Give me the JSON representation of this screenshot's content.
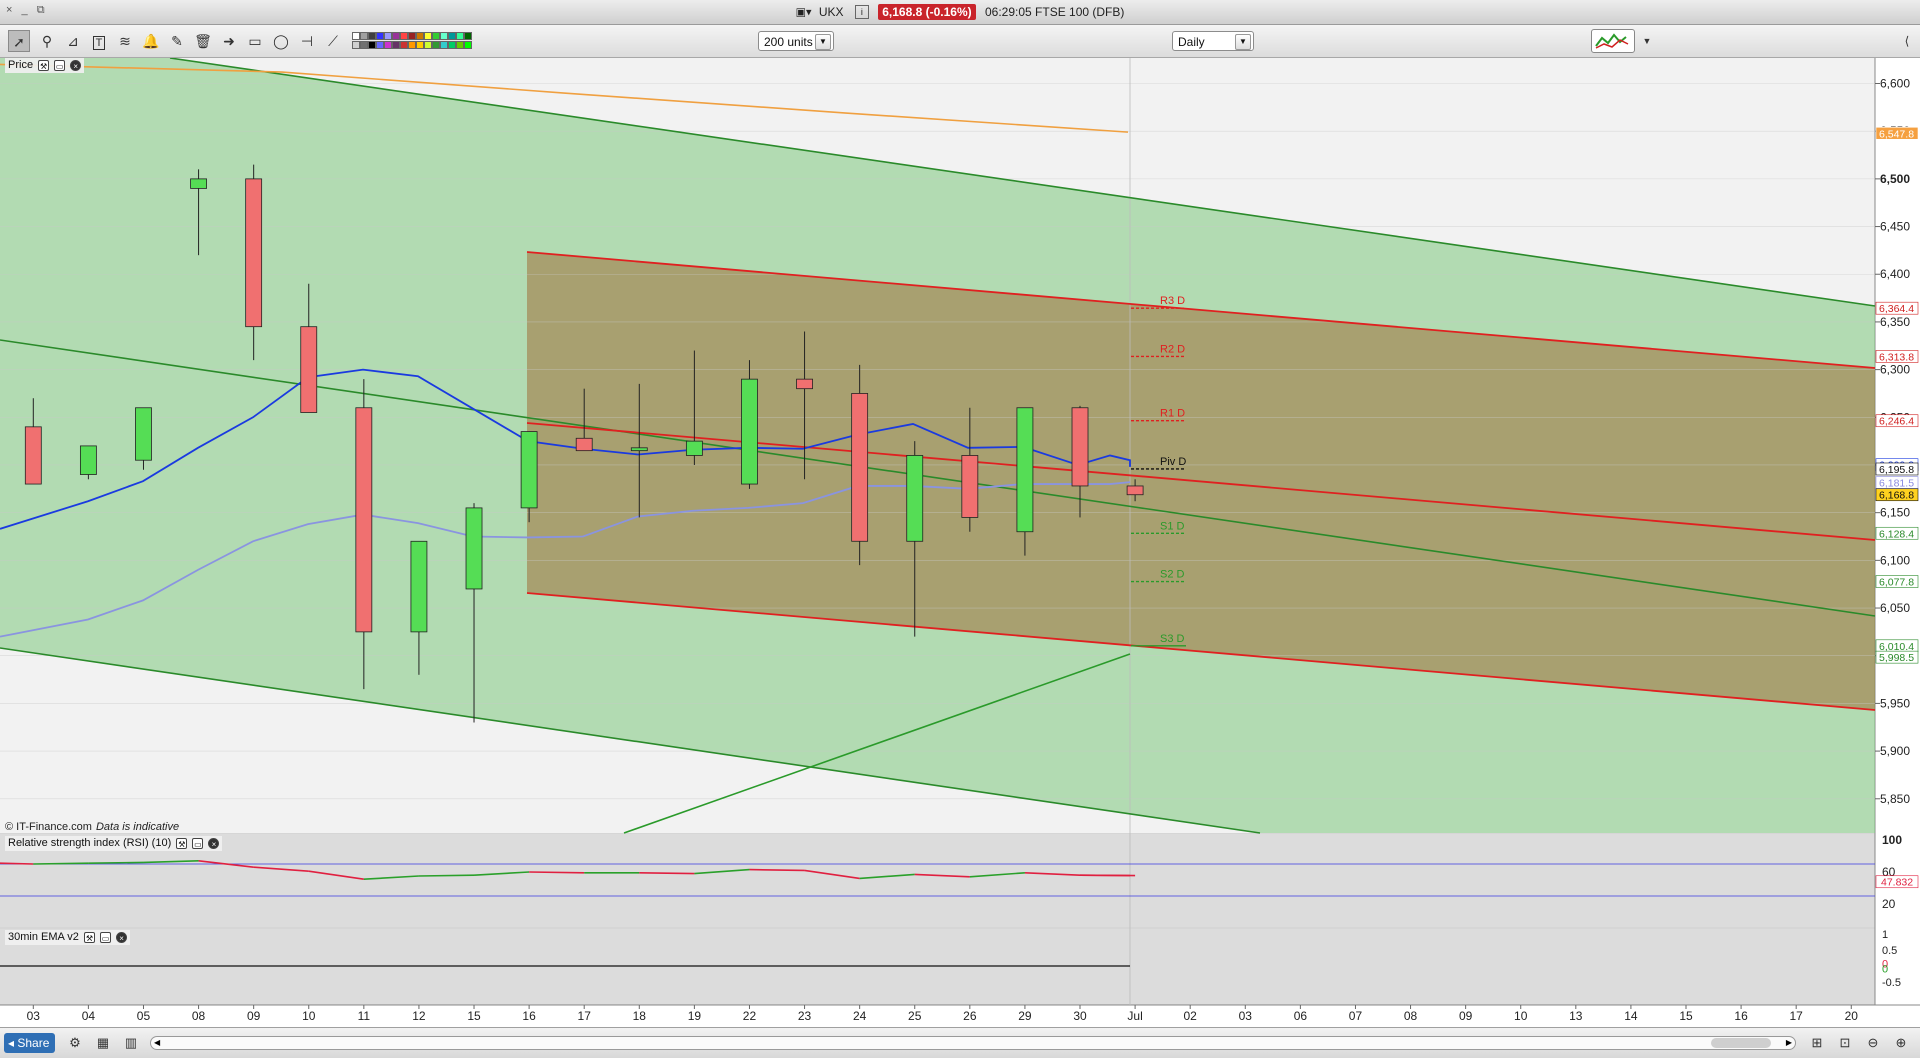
{
  "window": {
    "controls": [
      "×",
      "_",
      "⧉"
    ],
    "ticker": "UKX",
    "price_badge": "6,168.8 (-0.16%)",
    "time_title": "06:29:05 FTSE 100 (DFB)"
  },
  "toolbar": {
    "units_select": "200 units",
    "interval_select": "Daily",
    "tool_icons": [
      "pointer-icon",
      "magnifier-icon",
      "chart-settings-icon",
      "text-icon",
      "alert-bell-icon",
      "magic-wand-icon",
      "trash-icon",
      "arrow-icon",
      "rectangle-icon",
      "lasso-icon",
      "crosshair-line-icon",
      "trendline-icon"
    ],
    "swatches": [
      "#ffffff",
      "#d0d0d0",
      "#a0a0a0",
      "#707070",
      "#404040",
      "#000000",
      "#3333ff",
      "#6666ff",
      "#9999ff",
      "#cc33cc",
      "#993399",
      "#663366",
      "#ff4444",
      "#cc3333",
      "#992222",
      "#ff9900",
      "#cc7700",
      "#ffcc00",
      "#ffff33",
      "#ccff33",
      "#33cc33",
      "#339933",
      "#66ffcc",
      "#33cccc",
      "#009999",
      "#00cc66",
      "#33ff99",
      "#66cc00",
      "#006600",
      "#00ff00"
    ]
  },
  "panels": {
    "price_label": "Price",
    "rsi_label": "Relative strength index (RSI) (10)",
    "ema_label": "30min EMA v2",
    "copyright": "© IT-Finance.com",
    "indicative": "Data is indicative"
  },
  "bottombar": {
    "share_label": "Share",
    "left_arrow": "◀",
    "right_arrow": "▶"
  },
  "chart_data": {
    "type": "candlestick",
    "x_labels": [
      "03",
      "04",
      "05",
      "08",
      "09",
      "10",
      "11",
      "12",
      "15",
      "16",
      "17",
      "18",
      "19",
      "22",
      "23",
      "24",
      "25",
      "26",
      "29",
      "30",
      "Jul",
      "02",
      "03",
      "06",
      "07",
      "08",
      "09",
      "10",
      "13",
      "14",
      "15",
      "16",
      "17",
      "20"
    ],
    "y_ticks": [
      "6,600",
      "6,550",
      "6,500",
      "6,450",
      "6,400",
      "6,350",
      "6,300",
      "6,250",
      "6,200",
      "6,150",
      "6,100",
      "6,050",
      "6,000",
      "5,950",
      "5,900",
      "5,850"
    ],
    "y_range": [
      5810,
      6625
    ],
    "candles": [
      {
        "o": 6240,
        "h": 6270,
        "l": 6195,
        "c": 6180
      },
      {
        "o": 6190,
        "h": 6210,
        "l": 6185,
        "c": 6220
      },
      {
        "o": 6205,
        "h": 6250,
        "l": 6195,
        "c": 6260
      },
      {
        "o": 6490,
        "h": 6510,
        "l": 6420,
        "c": 6500
      },
      {
        "o": 6500,
        "h": 6515,
        "l": 6310,
        "c": 6345
      },
      {
        "o": 6345,
        "h": 6390,
        "l": 6255,
        "c": 6255
      },
      {
        "o": 6260,
        "h": 6290,
        "l": 5965,
        "c": 6025
      },
      {
        "o": 6025,
        "h": 6080,
        "l": 5980,
        "c": 6120
      },
      {
        "o": 6070,
        "h": 6160,
        "l": 5930,
        "c": 6155
      },
      {
        "o": 6155,
        "h": 6200,
        "l": 6140,
        "c": 6235
      },
      {
        "o": 6228,
        "h": 6280,
        "l": 6215,
        "c": 6215
      },
      {
        "o": 6215,
        "h": 6285,
        "l": 6145,
        "c": 6218
      },
      {
        "o": 6210,
        "h": 6320,
        "l": 6200,
        "c": 6225
      },
      {
        "o": 6180,
        "h": 6310,
        "l": 6175,
        "c": 6290
      },
      {
        "o": 6290,
        "h": 6340,
        "l": 6185,
        "c": 6280
      },
      {
        "o": 6275,
        "h": 6305,
        "l": 6095,
        "c": 6120
      },
      {
        "o": 6120,
        "h": 6225,
        "l": 6020,
        "c": 6210
      },
      {
        "o": 6210,
        "h": 6260,
        "l": 6130,
        "c": 6145
      },
      {
        "o": 6130,
        "h": 6260,
        "l": 6105,
        "c": 6260
      },
      {
        "o": 6260,
        "h": 6262,
        "l": 6145,
        "c": 6178
      },
      {
        "o": 6178,
        "h": 6185,
        "l": 6162,
        "c": 6168.8
      }
    ],
    "ma_blue": [
      6133,
      6162,
      6183,
      6218,
      6250,
      6292,
      6300,
      6293,
      6259,
      6225,
      6217,
      6211,
      6216,
      6218,
      6217,
      6232,
      6243,
      6218,
      6219,
      6200,
      6210,
      6205,
      6198
    ],
    "ma_lightblue": [
      6020,
      6038,
      6058,
      6090,
      6120,
      6138,
      6148,
      6139,
      6125,
      6124,
      6125,
      6146,
      6152,
      6155,
      6160,
      6178,
      6178,
      6175,
      6180,
      6180,
      6180,
      6182,
      6182
    ],
    "ma_orange": [
      6620,
      6612,
      6590,
      6569,
      6549
    ],
    "pivots": [
      {
        "name": "R3 D",
        "value": 6364.4,
        "color": "#e02020"
      },
      {
        "name": "R2 D",
        "value": 6313.8,
        "color": "#e02020"
      },
      {
        "name": "R1 D",
        "value": 6246.4,
        "color": "#e02020"
      },
      {
        "name": "Piv D",
        "value": 6195.8,
        "color": "#111111"
      },
      {
        "name": "S1 D",
        "value": 6128.4,
        "color": "#2a9a2a"
      },
      {
        "name": "S2 D",
        "value": 6077.8,
        "color": "#2a9a2a"
      },
      {
        "name": "S3 D",
        "value": 6010.4,
        "color": "#2a9a2a"
      }
    ],
    "axis_badges": [
      {
        "label": "6,547.8",
        "value": 6547.8,
        "bg": "#f5a040",
        "fg": "#ffffff"
      },
      {
        "label": "6,364.4",
        "value": 6364.4,
        "bg": "#ffffff",
        "fg": "#d02020"
      },
      {
        "label": "6,313.8",
        "value": 6313.8,
        "bg": "#ffffff",
        "fg": "#d02020"
      },
      {
        "label": "6,246.4",
        "value": 6246.4,
        "bg": "#ffffff",
        "fg": "#d02020"
      },
      {
        "label": "6,200.3",
        "value": 6200.3,
        "bg": "#ffffff",
        "fg": "#1a3ae0"
      },
      {
        "label": "6,195.8",
        "value": 6195.8,
        "bg": "#ffffff",
        "fg": "#111111"
      },
      {
        "label": "6,181.5",
        "value": 6181.5,
        "bg": "#ffffff",
        "fg": "#8a8ae0"
      },
      {
        "label": "6,168.8",
        "value": 6168.8,
        "bg": "#ffd21f",
        "fg": "#111111"
      },
      {
        "label": "6,128.4",
        "value": 6128.4,
        "bg": "#ffffff",
        "fg": "#2a8a2a"
      },
      {
        "label": "6,077.8",
        "value": 6077.8,
        "bg": "#ffffff",
        "fg": "#2a8a2a"
      },
      {
        "label": "6,010.4",
        "value": 6010.4,
        "bg": "#ffffff",
        "fg": "#2a8a2a"
      },
      {
        "label": "5,998.5",
        "value": 5998.5,
        "bg": "#ffffff",
        "fg": "#2a8a2a"
      }
    ],
    "rsi": {
      "ticks": [
        "100",
        "60",
        "20"
      ],
      "levels": [
        70,
        30
      ],
      "values": [
        71,
        70,
        71,
        72,
        74,
        66,
        61,
        51,
        55,
        56,
        60,
        59,
        59,
        58,
        63,
        62,
        52,
        57,
        54,
        59,
        56,
        55.5
      ],
      "last_label": "47.832"
    },
    "ema": {
      "ticks": [
        "1",
        "0.5",
        "0",
        "0",
        "-0.5"
      ],
      "last_values": [
        "0",
        "0"
      ]
    }
  }
}
